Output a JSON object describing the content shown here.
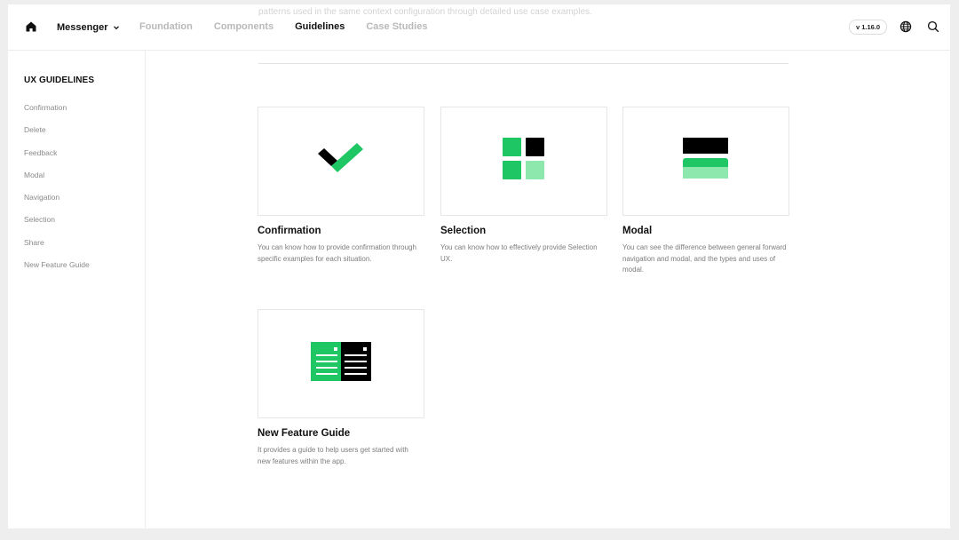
{
  "header": {
    "ghost_text": "patterns used in the same context configuration through detailed use case examples.",
    "brand": "Messenger",
    "nav": [
      "Foundation",
      "Components",
      "Guidelines",
      "Case Studies"
    ],
    "active_nav": "Guidelines",
    "version": "v 1.16.0"
  },
  "sidebar": {
    "title": "UX GUIDELINES",
    "items": [
      "Confirmation",
      "Delete",
      "Feedback",
      "Modal",
      "Navigation",
      "Selection",
      "Share",
      "New Feature Guide"
    ]
  },
  "cards": [
    {
      "title": "Confirmation",
      "description": "You can know how to provide confirmation through specific examples for each situation.",
      "icon": "checkmark-icon"
    },
    {
      "title": "Selection",
      "description": "You can know how to effectively provide Selection UX.",
      "icon": "grid-selection-icon"
    },
    {
      "title": "Modal",
      "description": "You can see the difference between general forward navigation and modal, and the types and uses of modal.",
      "icon": "modal-layers-icon"
    },
    {
      "title": "New Feature Guide",
      "description": "It provides a guide to help users get started with new features within the app.",
      "icon": "feature-guide-icon"
    }
  ],
  "colors": {
    "accent": "#1fc764",
    "accent_light": "#8de8ae",
    "dark": "#000000"
  }
}
